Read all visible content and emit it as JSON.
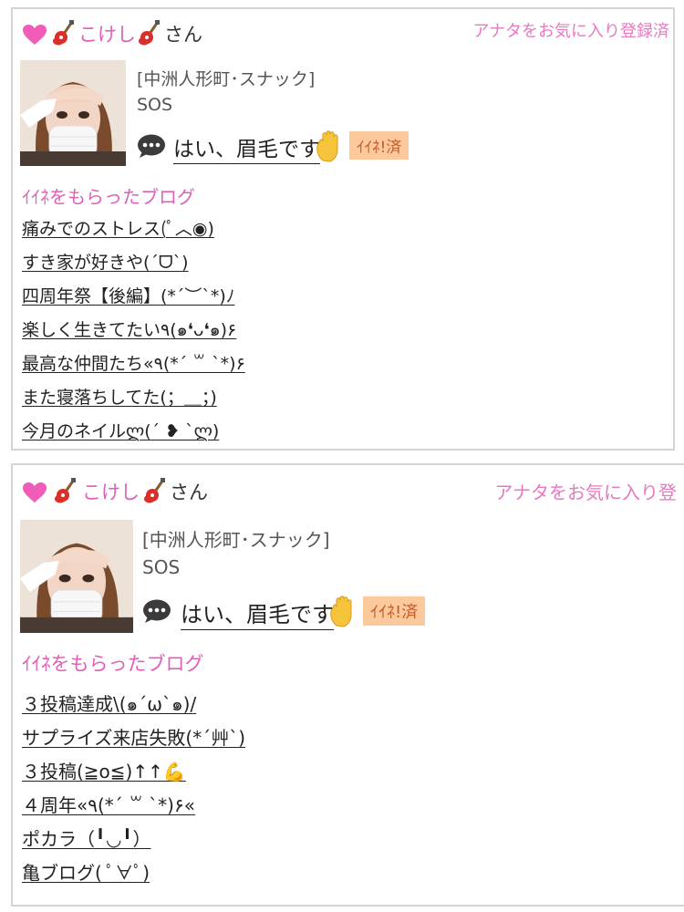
{
  "cards": [
    {
      "user_name": "こけし",
      "honorific": "さん",
      "favorite_status": "アナタをお気に入り登録済",
      "shop_area": "[中洲人形町･スナック]",
      "shop_name": "SOS",
      "comment": "はい、眉毛です",
      "like_badge": "ｲｲﾈ!済",
      "section_title": "ｲｲﾈをもらったブログ",
      "blogs": [
        "痛みでのストレス(ﾟ︿◉)",
        "すき家が好きや(´ᗜ`)",
        "四周年祭【後編】(*´︶`*)ﾉ",
        "楽しく生きてたい٩(๑❛ᴗ❛๑)۶",
        "最高な仲間たち«٩(*´ ꒳ `*)۶",
        "また寝落ちしてた(；＿；)",
        "今月のネイルლ(´ ❥ `ლ)"
      ]
    },
    {
      "user_name": "こけし",
      "honorific": "さん",
      "favorite_status": "アナタをお気に入り登",
      "shop_area": "[中洲人形町･スナック]",
      "shop_name": "SOS",
      "comment": "はい、眉毛です",
      "like_badge": "ｲｲﾈ!済",
      "section_title": "ｲｲﾈをもらったブログ",
      "blogs": [
        "３投稿達成\\(๑´ω`๑)/",
        "サプライズ来店失敗(*´艸`)",
        "３投稿(≧o≦)↑↑💪",
        "４周年«٩(*´ ꒳ `*)۶«",
        "ポカラ（╹◡╹）",
        "亀ブログ( ﾟ∀ﾟ)"
      ]
    }
  ],
  "colors": {
    "pink": "#e060b8",
    "favorite_text": "#e878c0",
    "badge_bg": "#fbc99c",
    "border": "#d4d4d4"
  },
  "icons": [
    "heart-icon",
    "guitar-icon",
    "speech-bubble-icon",
    "raised-hand-icon"
  ]
}
